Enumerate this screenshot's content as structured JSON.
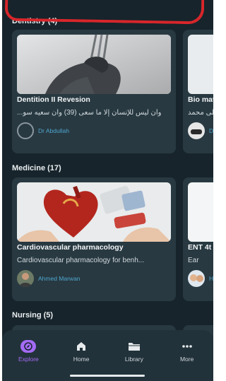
{
  "sections": {
    "dentistry": {
      "title": "Dentistry (4)",
      "cards": [
        {
          "title": "Dentition II Revesion",
          "description": "وأن ليس للإنسان إلا ما سعى (39) وأن سعيه سو...",
          "author": "Dr Abdullah"
        },
        {
          "title": "Bio mat",
          "description": "على محمد",
          "author": "D"
        }
      ]
    },
    "medicine": {
      "title": "Medicine (17)",
      "cards": [
        {
          "title": "Cardiovascular pharmacology",
          "description": "Cardiovascular pharmacology for benh...",
          "author": "Ahmed Marwan"
        },
        {
          "title": "ENT 4t",
          "description": "Ear",
          "author": "H"
        }
      ]
    },
    "nursing": {
      "title": "Nursing (5)"
    }
  },
  "nav": {
    "explore": "Explore",
    "home": "Home",
    "library": "Library",
    "more": "More"
  },
  "icons": {
    "explore": "compass-icon",
    "home": "home-icon",
    "library": "folder-icon",
    "more": "more-dots-icon"
  },
  "colors": {
    "background": "#17242b",
    "card": "#283941",
    "accent": "#a46bf5",
    "author_link": "#4fa6cf"
  }
}
